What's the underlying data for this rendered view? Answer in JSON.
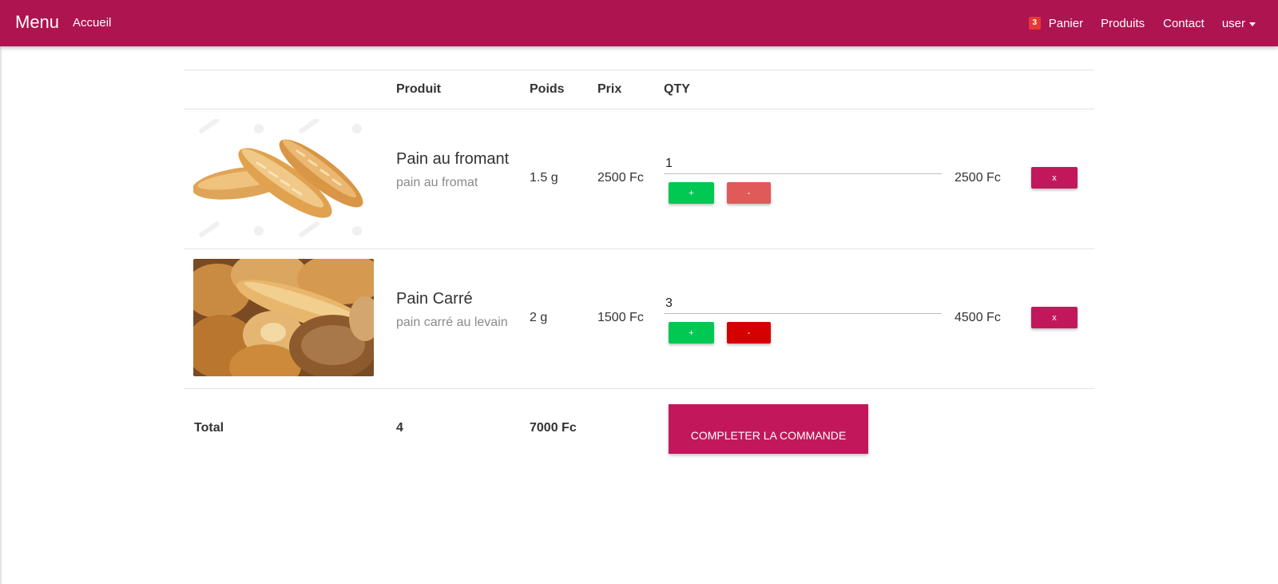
{
  "nav": {
    "brand": "Menu",
    "home": "Accueil",
    "cart_count": "3",
    "cart": "Panier",
    "products": "Produits",
    "contact": "Contact",
    "user": "user"
  },
  "table": {
    "headers": {
      "product": "Produit",
      "weight": "Poids",
      "price": "Prix",
      "qty": "QTY"
    },
    "rows": [
      {
        "name": "Pain au fromant",
        "description": "pain au fromat",
        "weight": "1.5 g",
        "price": "2500 Fc",
        "qty": "1",
        "subtotal": "2500 Fc",
        "plus_label": "+",
        "minus_label": "-",
        "remove_label": "x",
        "minus_color": "#e05a5a"
      },
      {
        "name": "Pain Carré",
        "description": "pain carré au levain",
        "weight": "2 g",
        "price": "1500 Fc",
        "qty": "3",
        "subtotal": "4500 Fc",
        "plus_label": "+",
        "minus_label": "-",
        "remove_label": "x",
        "minus_color": "#d50000"
      }
    ]
  },
  "total": {
    "label": "Total",
    "quantity": "4",
    "amount": "7000 Fc",
    "checkout_label": "COMPLETER LA COMMANDE"
  },
  "colors": {
    "navbar": "#ad1450",
    "accent": "#c2185b",
    "plus": "#00c853",
    "badge": "#e53935"
  }
}
